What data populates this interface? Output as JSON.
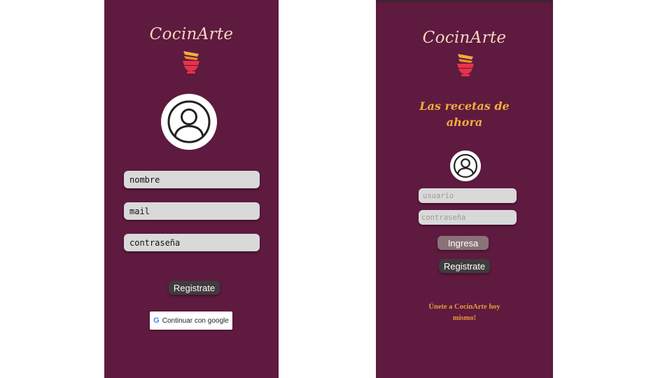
{
  "colors": {
    "page_background": "#ffffff",
    "phone_background": "#5f1a3f",
    "logo_text": "#f3d6bf",
    "tagline": "#f2ad3b",
    "field_background": "#d9d9d9",
    "button_dark": "#413b3e",
    "button_light": "#8a7278"
  },
  "register_screen": {
    "logo": "CocinArte",
    "logo_icon": "bowl-icon",
    "avatar_icon": "user-icon",
    "fields": {
      "name_value": "nombre",
      "mail_value": "mail",
      "password_value": "contraseña"
    },
    "register_button": "Registrate",
    "google_button": {
      "icon": "google-icon",
      "label": "Continuar con google"
    }
  },
  "login_screen": {
    "logo": "CocinArte",
    "logo_icon": "bowl-icon",
    "tagline_line1": "Las recetas de",
    "tagline_line2": "ahora",
    "avatar_icon": "user-icon",
    "fields": {
      "username_placeholder": "usuario",
      "password_placeholder": "contraseña"
    },
    "login_button": "Ingresa",
    "register_button": "Registrate",
    "promo_line1": "Únete a CocinArte hoy",
    "promo_line2": "mismo!"
  }
}
